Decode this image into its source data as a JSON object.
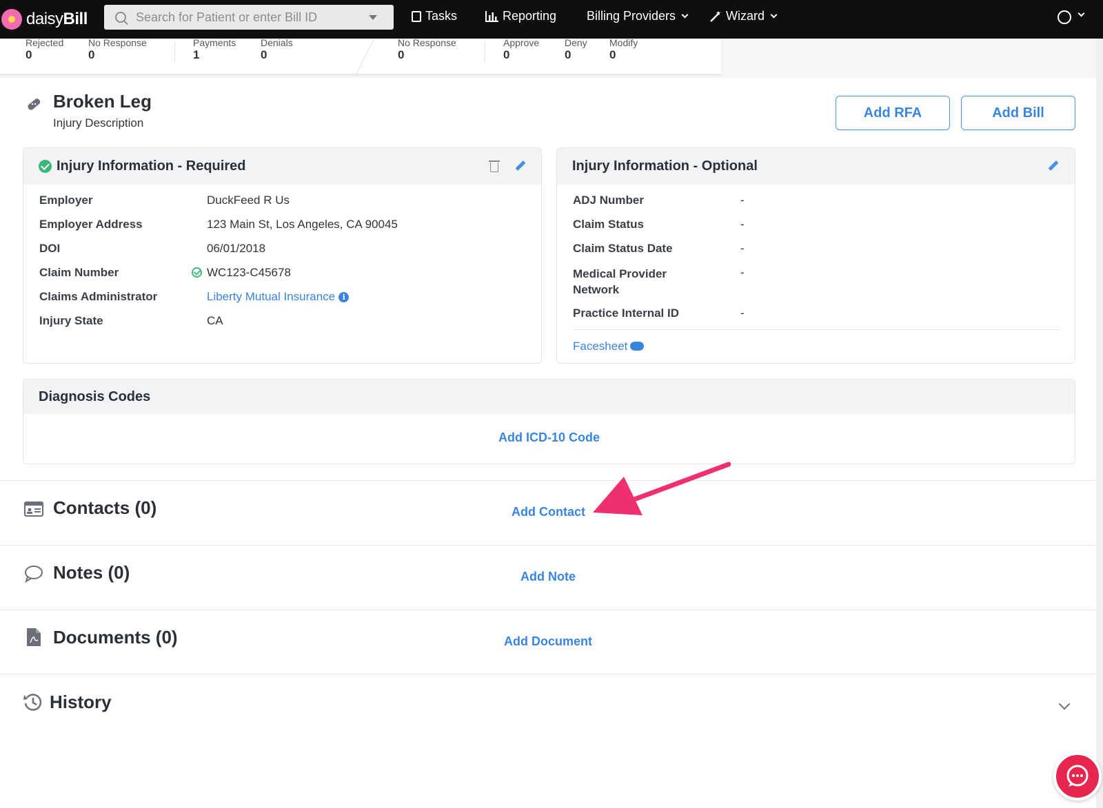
{
  "nav": {
    "brand_light": "daisy",
    "brand_bold": "Bill",
    "search_placeholder": "Search for Patient or enter Bill ID",
    "tasks": "Tasks",
    "reporting": "Reporting",
    "billing_providers": "Billing Providers",
    "wizard": "Wizard"
  },
  "stats": {
    "group1": [
      {
        "label": "Rejected",
        "value": "0"
      },
      {
        "label": "No Response",
        "value": "0"
      },
      {
        "label": "Payments",
        "value": "1"
      },
      {
        "label": "Denials",
        "value": "0"
      }
    ],
    "group2": [
      {
        "label": "No Response",
        "value": "0"
      },
      {
        "label": "Approve",
        "value": "0"
      },
      {
        "label": "Deny",
        "value": "0"
      },
      {
        "label": "Modify",
        "value": "0"
      }
    ]
  },
  "header": {
    "title": "Broken Leg",
    "subtitle": "Injury Description",
    "add_rfa": "Add RFA",
    "add_bill": "Add Bill"
  },
  "required_card": {
    "title": "Injury Information - Required",
    "rows": [
      {
        "label": "Employer",
        "value": "DuckFeed R Us"
      },
      {
        "label": "Employer Address",
        "value": "123 Main St, Los Angeles, CA 90045"
      },
      {
        "label": "DOI",
        "value": "06/01/2018"
      },
      {
        "label": "Claim Number",
        "value": "WC123-C45678"
      },
      {
        "label": "Claims Administrator",
        "value": "Liberty Mutual Insurance"
      },
      {
        "label": "Injury State",
        "value": "CA"
      }
    ]
  },
  "optional_card": {
    "title": "Injury Information - Optional",
    "rows": [
      {
        "label": "ADJ Number",
        "value": "-"
      },
      {
        "label": "Claim Status",
        "value": "-"
      },
      {
        "label": "Claim Status Date",
        "value": "-"
      },
      {
        "label": "Medical Provider Network",
        "value": "-"
      },
      {
        "label": "Practice Internal ID",
        "value": "-"
      }
    ],
    "facesheet": "Facesheet"
  },
  "diagnosis": {
    "title": "Diagnosis Codes",
    "add_link": "Add ICD-10 Code"
  },
  "sections": {
    "contacts": {
      "title": "Contacts (0)",
      "link": "Add Contact"
    },
    "notes": {
      "title": "Notes (0)",
      "link": "Add Note"
    },
    "documents": {
      "title": "Documents (0)",
      "link": "Add Document"
    },
    "history": {
      "title": "History"
    }
  },
  "colors": {
    "accent": "#3a85dc",
    "success": "#3cb878",
    "annotation_arrow": "#f0306e",
    "chat": "#e6264f"
  }
}
